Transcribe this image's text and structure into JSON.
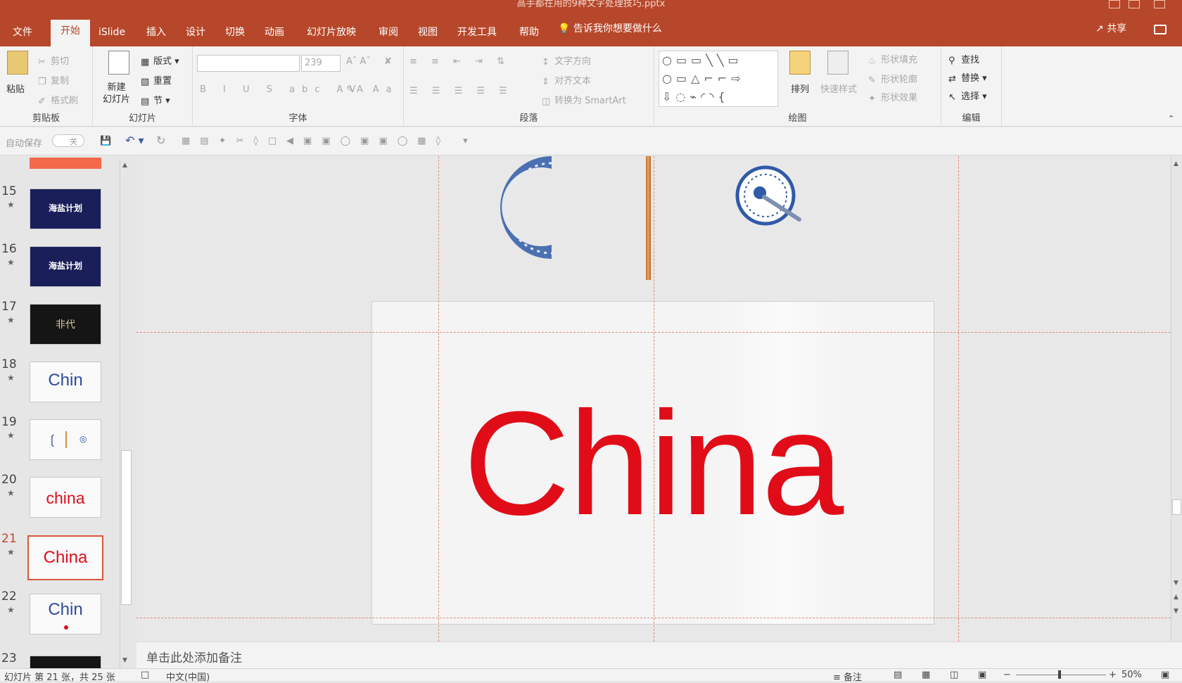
{
  "window": {
    "title": "高手都在用的9种文字处理技巧.pptx"
  },
  "tabs": [
    "文件",
    "开始",
    "iSlide",
    "插入",
    "设计",
    "切换",
    "动画",
    "幻灯片放映",
    "审阅",
    "视图",
    "开发工具",
    "帮助"
  ],
  "active_tab": "开始",
  "tell_me": "告诉我你想要做什么",
  "share": "共享",
  "ribbon": {
    "clipboard": {
      "label": "剪贴板",
      "paste": "粘贴",
      "cut": "剪切",
      "copy": "复制",
      "format_painter": "格式刷"
    },
    "slides": {
      "label": "幻灯片",
      "new_slide": "新建",
      "new_slide2": "幻灯片",
      "layout": "版式",
      "reset": "重置",
      "section": "节"
    },
    "font": {
      "label": "字体",
      "font_name": "",
      "font_size": "239"
    },
    "paragraph": {
      "label": "段落",
      "text_direction": "文字方向",
      "align_text": "对齐文本",
      "smartart": "转换为 SmartArt"
    },
    "drawing": {
      "label": "绘图",
      "arrange": "排列",
      "quick_styles": "快速样式",
      "shape_fill": "形状填充",
      "shape_outline": "形状轮廓",
      "shape_effects": "形状效果"
    },
    "editing": {
      "label": "编辑",
      "find": "查找",
      "replace": "替换",
      "select": "选择"
    }
  },
  "qat": {
    "autosave": "自动保存",
    "autosave_state": "关"
  },
  "thumbnails": [
    {
      "num": "15",
      "text": "海盐计划",
      "style": "dark"
    },
    {
      "num": "16",
      "text": "海盐计划",
      "style": "dark"
    },
    {
      "num": "17",
      "text": "非代",
      "style": "black"
    },
    {
      "num": "18",
      "text": "Chin",
      "style": "light"
    },
    {
      "num": "19",
      "text": "",
      "style": "light"
    },
    {
      "num": "20",
      "text": "china",
      "style": "light"
    },
    {
      "num": "21",
      "text": "China",
      "style": "light",
      "selected": true
    },
    {
      "num": "22",
      "text": "Chin",
      "style": "light"
    },
    {
      "num": "23",
      "text": "",
      "style": "black"
    }
  ],
  "slide": {
    "word": "China",
    "word_color": "#e00d18"
  },
  "notes_placeholder": "单击此处添加备注",
  "status": {
    "slide_info": "幻灯片 第 21 张，共 25 张",
    "language": "中文(中国)",
    "notes": "备注",
    "zoom": "50%"
  },
  "colors": {
    "accent": "#b7472a",
    "guide": "#e08a70"
  }
}
